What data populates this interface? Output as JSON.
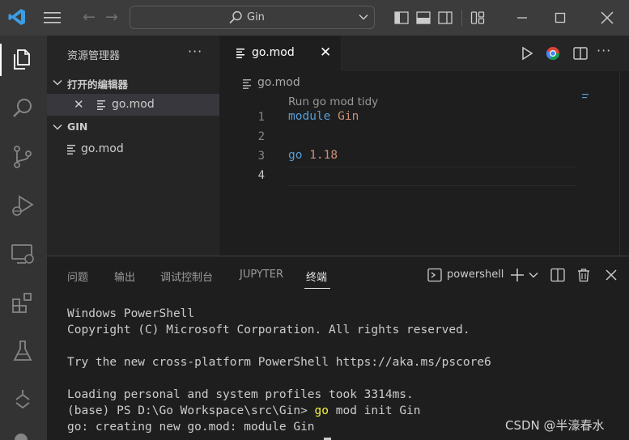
{
  "titlebar": {
    "search_text": "Gin"
  },
  "sidebar": {
    "title": "资源管理器",
    "more": "···",
    "open_editors_label": "打开的编辑器",
    "open_editors": [
      {
        "name": "go.mod"
      }
    ],
    "folder_label": "GIN",
    "files": [
      {
        "name": "go.mod"
      }
    ]
  },
  "editor": {
    "tab_name": "go.mod",
    "tab_close": "✕",
    "more": "···",
    "breadcrumb": "go.mod",
    "codelens": "Run go mod tidy",
    "line_numbers": [
      "1",
      "2",
      "3",
      "4"
    ],
    "lines": [
      {
        "keyword": "module",
        "value": "Gin"
      },
      {
        "keyword": "",
        "value": ""
      },
      {
        "keyword": "go",
        "value": "1.18"
      },
      {
        "keyword": "",
        "value": ""
      }
    ]
  },
  "panel": {
    "tabs": [
      "问题",
      "输出",
      "调试控制台",
      "JUPYTER",
      "终端"
    ],
    "active_tab": "终端",
    "shell": "powershell",
    "terminal": {
      "line1": "Windows PowerShell",
      "line2": "Copyright (C) Microsoft Corporation. All rights reserved.",
      "line3": "Try the new cross-platform PowerShell https://aka.ms/pscore6",
      "line4": "Loading personal and system profiles took 3314ms.",
      "prompt": "(base) PS D:\\Go Workspace\\src\\Gin> ",
      "cmd_go": "go",
      "cmd_rest": " mod init Gin",
      "line6": "go: creating new go.mod: module Gin"
    }
  },
  "watermark": "CSDN @半濠春水",
  "colors": {
    "accent_blue": "#3b9de5",
    "keyword": "#569cd6",
    "string": "#ce9178",
    "number": "#b5cea8",
    "terminal_command": "#f5f543"
  }
}
